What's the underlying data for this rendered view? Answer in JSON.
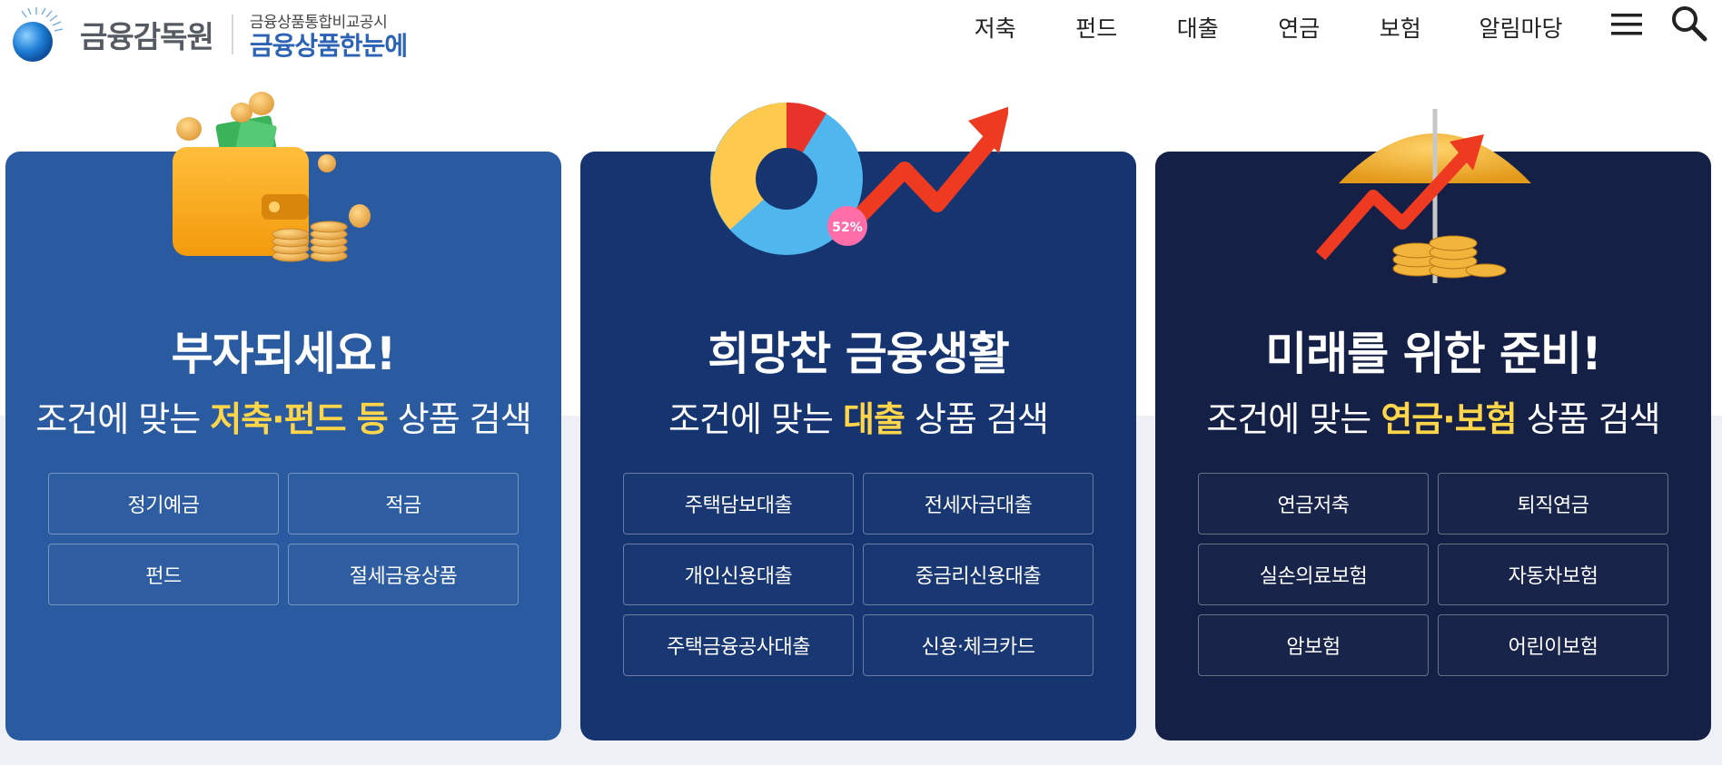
{
  "header": {
    "logo_name": "금융감독원",
    "logo_sub_top": "금융상품통합비교공시",
    "logo_sub_main": "금융상품한눈에",
    "nav": [
      "저축",
      "펀드",
      "대출",
      "연금",
      "보험",
      "알림마당"
    ],
    "menu_icon": "hamburger-menu-icon",
    "search_icon": "search-icon"
  },
  "cards": [
    {
      "title": "부자되세요!",
      "sub_pre": "조건에 맞는 ",
      "sub_hl": "저축·펀드 등",
      "sub_post": " 상품 검색",
      "buttons": [
        "정기예금",
        "적금",
        "펀드",
        "절세금융상품"
      ],
      "icon": "wallet-coins-icon"
    },
    {
      "title": "희망찬 금융생활",
      "sub_pre": "조건에 맞는 ",
      "sub_hl": "대출",
      "sub_post": " 상품 검색",
      "buttons": [
        "주택담보대출",
        "전세자금대출",
        "개인신용대출",
        "중금리신용대출",
        "주택금융공사대출",
        "신용·체크카드"
      ],
      "icon": "pie-chart-arrow-icon",
      "badge": "52%"
    },
    {
      "title": "미래를 위한 준비!",
      "sub_pre": "조건에 맞는 ",
      "sub_hl": "연금·보험",
      "sub_post": " 상품 검색",
      "buttons": [
        "연금저축",
        "퇴직연금",
        "실손의료보험",
        "자동차보험",
        "암보험",
        "어린이보험"
      ],
      "icon": "umbrella-coins-icon"
    }
  ],
  "colors": {
    "card1": "#2a5aa0",
    "card2": "#153470",
    "card3": "#142046",
    "highlight": "#ffd54a",
    "brand_blue": "#2c63b5"
  }
}
